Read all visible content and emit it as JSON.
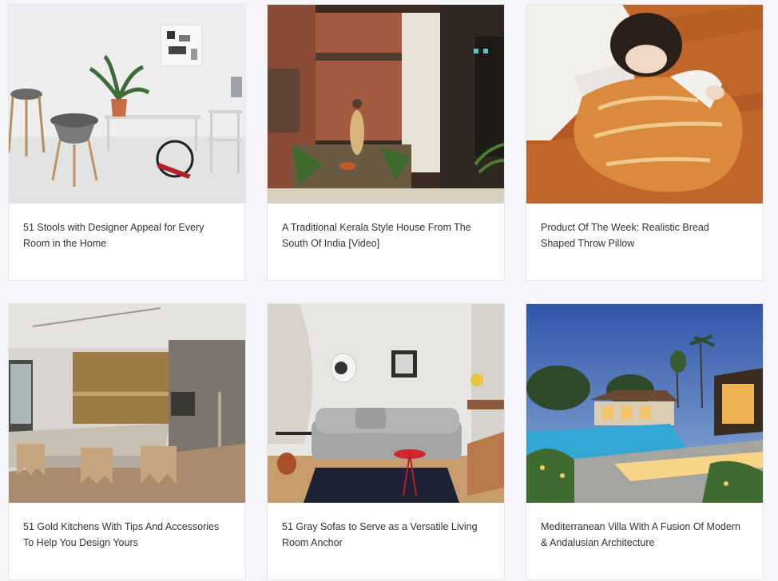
{
  "articles": [
    {
      "title": "51 Stools with Designer Appeal for Every Room in the Home"
    },
    {
      "title": "A Traditional Kerala Style House From The South Of India [Video]"
    },
    {
      "title": "Product Of The Week: Realistic Bread Shaped Throw Pillow"
    },
    {
      "title": "51 Gold Kitchens With Tips And Accessories To Help You Design Yours"
    },
    {
      "title": "51 Gray Sofas to Serve as a Versatile Living Room Anchor"
    },
    {
      "title": "Mediterranean Villa With A Fusion Of Modern & Andalusian Architecture"
    }
  ]
}
